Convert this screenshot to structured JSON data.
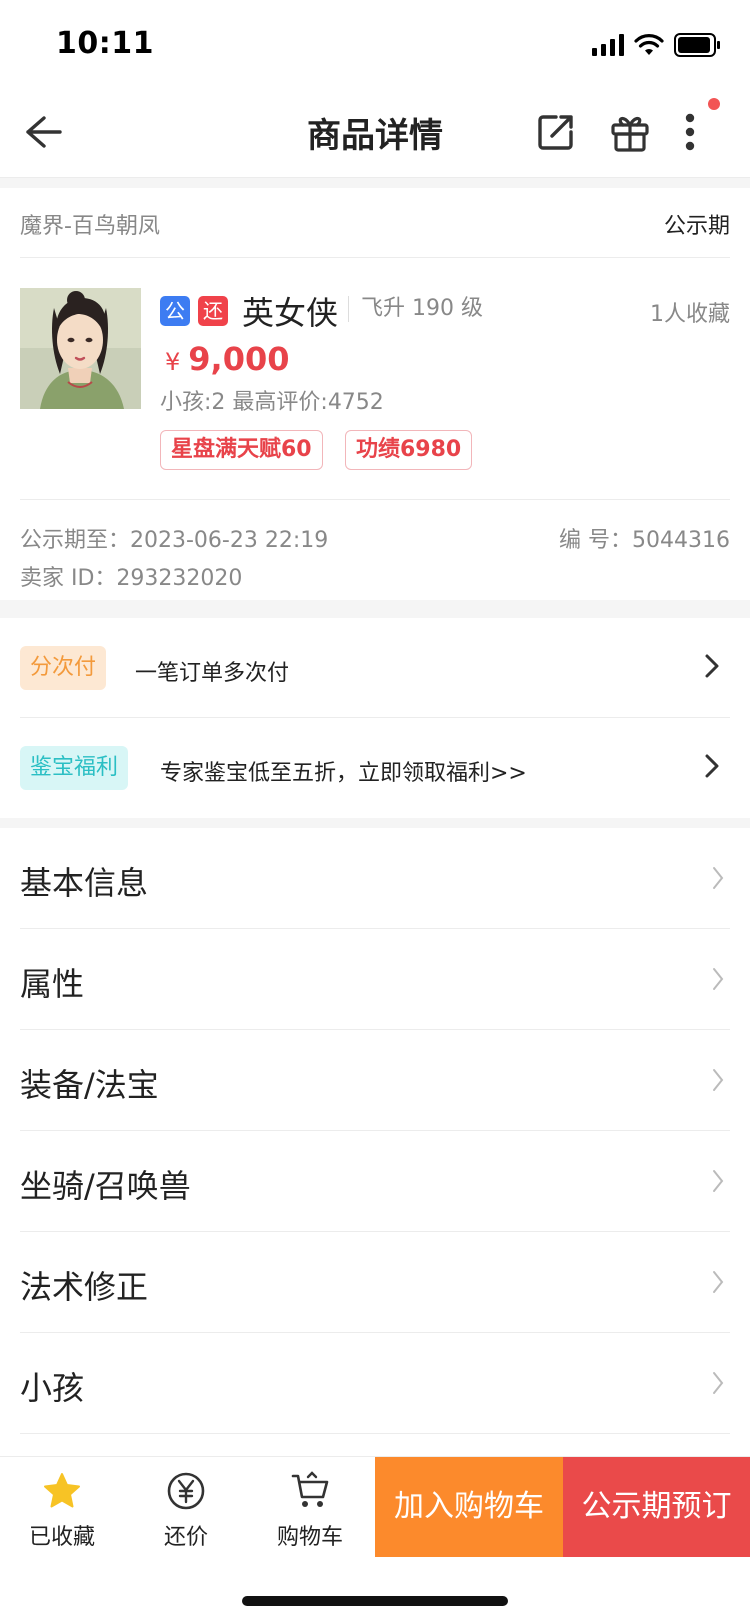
{
  "status_bar": {
    "time": "10:11"
  },
  "nav": {
    "title": "商品详情"
  },
  "server": {
    "name": "魔界-百鸟朝凤",
    "status": "公示期"
  },
  "product": {
    "tag_public": "公",
    "tag_bargain": "还",
    "name": "英女侠",
    "level": "飞升 190 级",
    "favorites": "1人收藏",
    "currency": "¥",
    "price": "9,000",
    "sub": "小孩:2 最高评价:4752",
    "badges": [
      "星盘满天赋60",
      "功绩6980"
    ]
  },
  "meta": {
    "deadline": "公示期至：2023-06-23 22:19",
    "code": "编 号：5044316",
    "seller": "卖家 ID：293232020"
  },
  "promos": [
    {
      "pill": "分次付",
      "text": "一笔订单多次付"
    },
    {
      "pill": "鉴宝福利",
      "text": "专家鉴宝低至五折，立即领取福利>>"
    }
  ],
  "sections": [
    "基本信息",
    "属性",
    "装备/法宝",
    "坐骑/召唤兽",
    "法术修正",
    "小孩"
  ],
  "bottom_bar": {
    "favorite_label": "已收藏",
    "bargain_label": "还价",
    "cart_label": "购物车",
    "add_to_cart": "加入购物车",
    "reserve": "公示期预订"
  },
  "colors": {
    "price_red": "#e8434a",
    "star_yellow": "#f7c325",
    "cart_orange": "#fc8a2c",
    "reserve_red": "#ea4a4a",
    "tag_blue": "#3d7cf2"
  }
}
